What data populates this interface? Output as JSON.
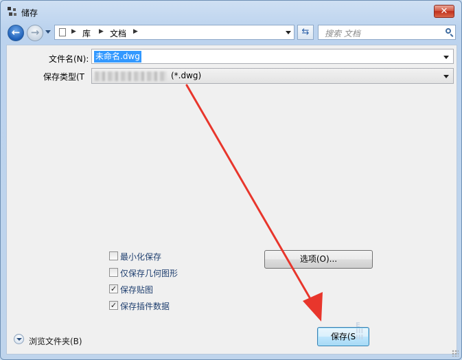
{
  "window": {
    "title": "储存",
    "close_label": "✕"
  },
  "nav": {
    "back_glyph": "←",
    "forward_glyph": "→",
    "breadcrumb": [
      "库",
      "文档"
    ],
    "refresh_glyph": "⇆",
    "search_placeholder": "搜索 文档"
  },
  "form": {
    "filename_label": "文件名(N):",
    "filename_value": "未命名.dwg",
    "filetype_label": "保存类型(T):",
    "filetype_label_visible": "保存类型(T",
    "filetype_value": "(*.dwg)"
  },
  "options": {
    "checkboxes": [
      {
        "label": "最小化保存",
        "checked": false
      },
      {
        "label": "仅保存几何图形",
        "checked": false
      },
      {
        "label": "保存贴图",
        "checked": true
      },
      {
        "label": "保存插件数据",
        "checked": true
      }
    ],
    "options_button": "选项(O)..."
  },
  "footer": {
    "browse_label": "浏览文件夹(B)",
    "save_button": "保存(S)",
    "save_button_visible": "保存(S"
  },
  "colors": {
    "annotation_arrow": "#e8362c",
    "selection": "#3399ff"
  }
}
